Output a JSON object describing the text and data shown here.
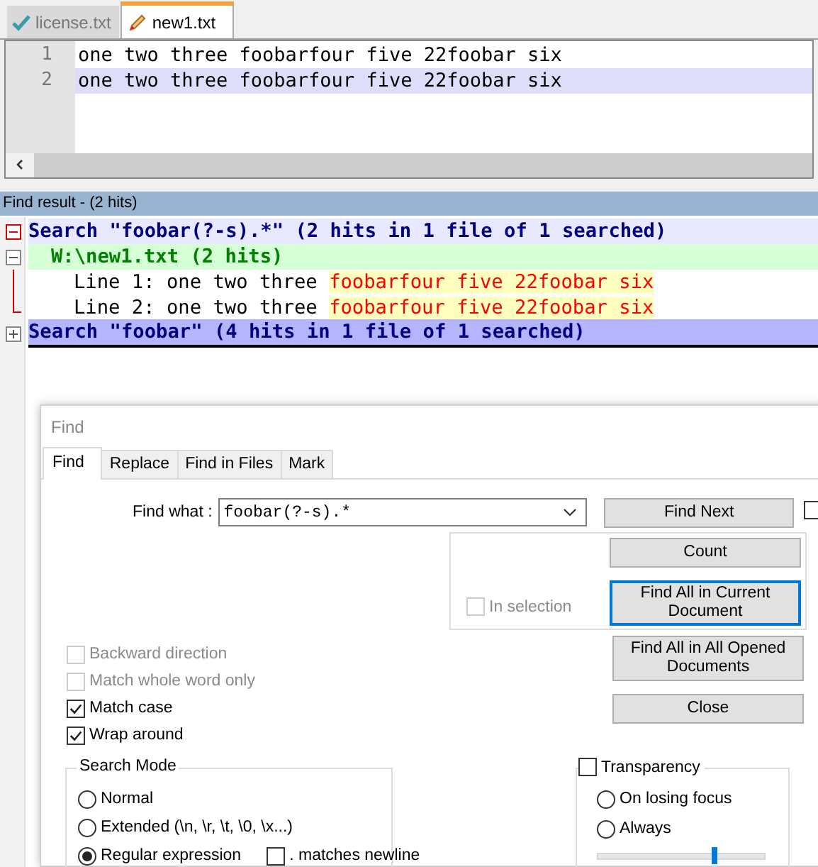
{
  "tabs": [
    {
      "label": "license.txt",
      "kind": "saved",
      "selected": false
    },
    {
      "label": "new1.txt",
      "kind": "modified",
      "selected": true
    }
  ],
  "editor": {
    "lines": [
      {
        "number": "1",
        "text": "one two three foobarfour five 22foobar six",
        "current": false
      },
      {
        "number": "2",
        "text": "one two three foobarfour five 22foobar six",
        "current": true
      }
    ]
  },
  "find_result": {
    "title": "Find result - (2 hits)",
    "searches": [
      {
        "header": "Search \"foobar(?-s).*\" (2 hits in 1 file of 1 searched)",
        "expanded": true,
        "selected": false,
        "files": [
          {
            "path": "W:\\new1.txt (2 hits)",
            "expanded": true,
            "hits": [
              {
                "prefix": "Line 1: one two three ",
                "match": "foobarfour five 22foobar six"
              },
              {
                "prefix": "Line 2: one two three ",
                "match": "foobarfour five 22foobar six"
              }
            ]
          }
        ]
      },
      {
        "header": "Search \"foobar\" (4 hits in 1 file of 1 searched)",
        "expanded": false,
        "selected": true
      }
    ]
  },
  "dialog": {
    "title": "Find",
    "tabs": [
      {
        "label": "Find",
        "selected": true
      },
      {
        "label": "Replace",
        "selected": false
      },
      {
        "label": "Find in Files",
        "selected": false
      },
      {
        "label": "Mark",
        "selected": false
      }
    ],
    "find_what": {
      "label": "Find what :",
      "value": "foobar(?-s).*"
    },
    "find_next": {
      "label": "Find Next",
      "focused": false
    },
    "side_checkbox": {
      "checked": false
    },
    "in_selection": {
      "label": "In selection",
      "checked": false,
      "disabled": true
    },
    "count": {
      "label": "Count",
      "focused": false
    },
    "find_all_current": {
      "label": "Find All in Current Document",
      "focused": true
    },
    "options": [
      {
        "label": "Backward direction",
        "checked": false,
        "disabled": true
      },
      {
        "label": "Match whole word only",
        "checked": false,
        "disabled": true
      },
      {
        "label": "Match case",
        "checked": true,
        "disabled": false
      },
      {
        "label": "Wrap around",
        "checked": true,
        "disabled": false
      }
    ],
    "find_all_opened": {
      "label": "Find All in All Opened Documents",
      "focused": false
    },
    "close": {
      "label": "Close",
      "focused": false
    },
    "search_mode": {
      "title": "Search Mode",
      "modes": [
        {
          "label": "Normal",
          "selected": false
        },
        {
          "label": "Extended (\\n, \\r, \\t, \\0, \\x...)",
          "selected": false
        },
        {
          "label": "Regular expression",
          "selected": true
        }
      ],
      "dot_newline": {
        "label": ". matches newline",
        "checked": false
      }
    },
    "transparency": {
      "label": "Transparency",
      "checked": false,
      "options": [
        {
          "label": "On losing focus",
          "selected": false
        },
        {
          "label": "Always",
          "selected": false
        }
      ],
      "slider": {
        "level": 0.7
      }
    }
  }
}
